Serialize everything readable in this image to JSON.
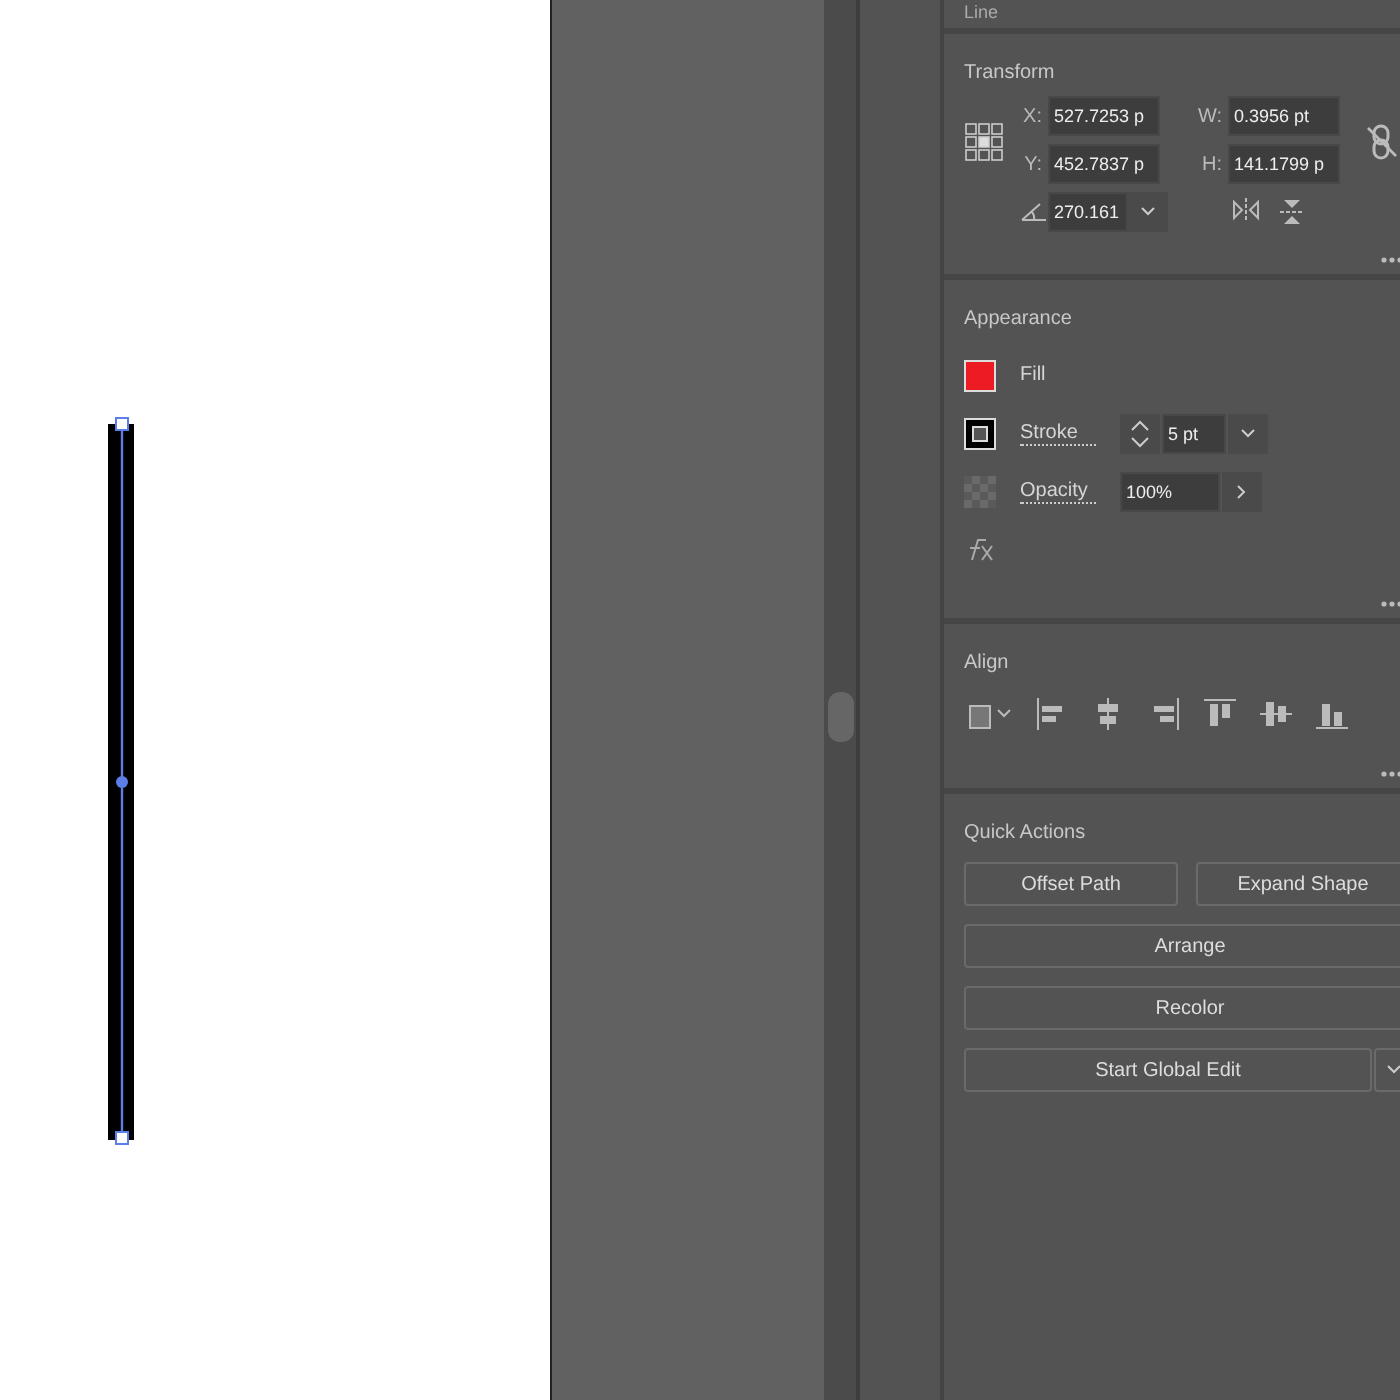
{
  "selection": {
    "label": "Line"
  },
  "transform": {
    "title": "Transform",
    "fields": [
      {
        "label": "X:",
        "value": "527.7253 p"
      },
      {
        "label": "W:",
        "value": "0.3956 pt"
      },
      {
        "label": "Y:",
        "value": "452.7837 p"
      },
      {
        "label": "H:",
        "value": "141.1799 p"
      }
    ],
    "angle": {
      "value": "270.161"
    }
  },
  "appearance": {
    "title": "Appearance",
    "rows": [
      {
        "kind": "fill",
        "label": "Fill",
        "color": "#ed1c24"
      },
      {
        "kind": "stroke",
        "label": "Stroke",
        "value": "5 pt"
      },
      {
        "kind": "opacity",
        "label": "Opacity",
        "value": "100%"
      }
    ]
  },
  "align": {
    "title": "Align"
  },
  "quick_actions": {
    "title": "Quick Actions",
    "buttons": [
      {
        "kind": "half",
        "label": "Offset Path"
      },
      {
        "kind": "half",
        "label": "Expand Shape"
      },
      {
        "kind": "full",
        "label": "Arrange"
      },
      {
        "kind": "full",
        "label": "Recolor"
      },
      {
        "kind": "split",
        "label": "Start Global Edit"
      }
    ]
  }
}
